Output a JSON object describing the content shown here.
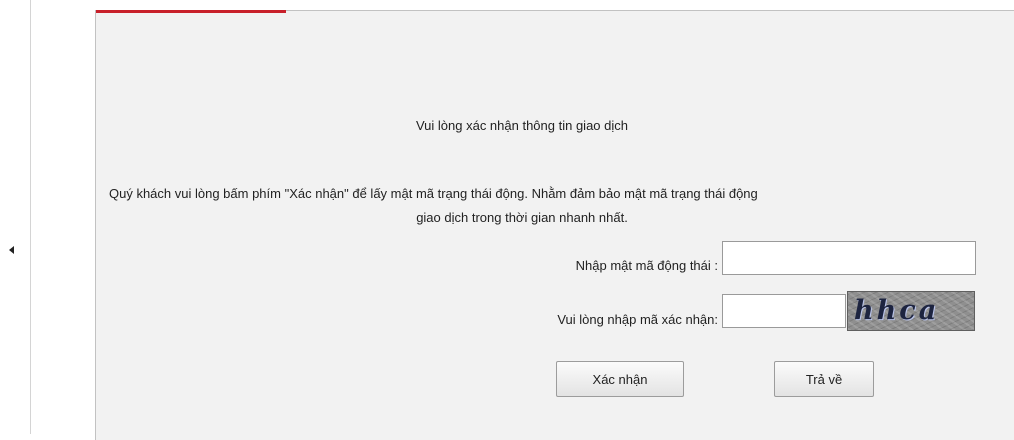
{
  "page": {
    "title": "Vui lòng xác nhận thông tin giao dịch",
    "instruction_line1": "Quý khách vui lòng bấm phím \"Xác nhận\" để lấy mật mã trạng thái động. Nhằm đảm bảo mật mã trạng thái động",
    "instruction_line2": "giao dịch trong thời gian nhanh nhất."
  },
  "form": {
    "otp_label": "Nhập mật mã động thái :",
    "otp_value": "",
    "captcha_label": "Vui lòng nhập mã xác nhận:",
    "captcha_value": "",
    "captcha_text": "hhca"
  },
  "buttons": {
    "confirm_label": "Xác nhận",
    "back_label": "Trả về"
  },
  "colors": {
    "accent": "#c8202a",
    "panel_background": "#f2f2f2"
  },
  "icons": {
    "collapse": "caret-left-icon"
  }
}
